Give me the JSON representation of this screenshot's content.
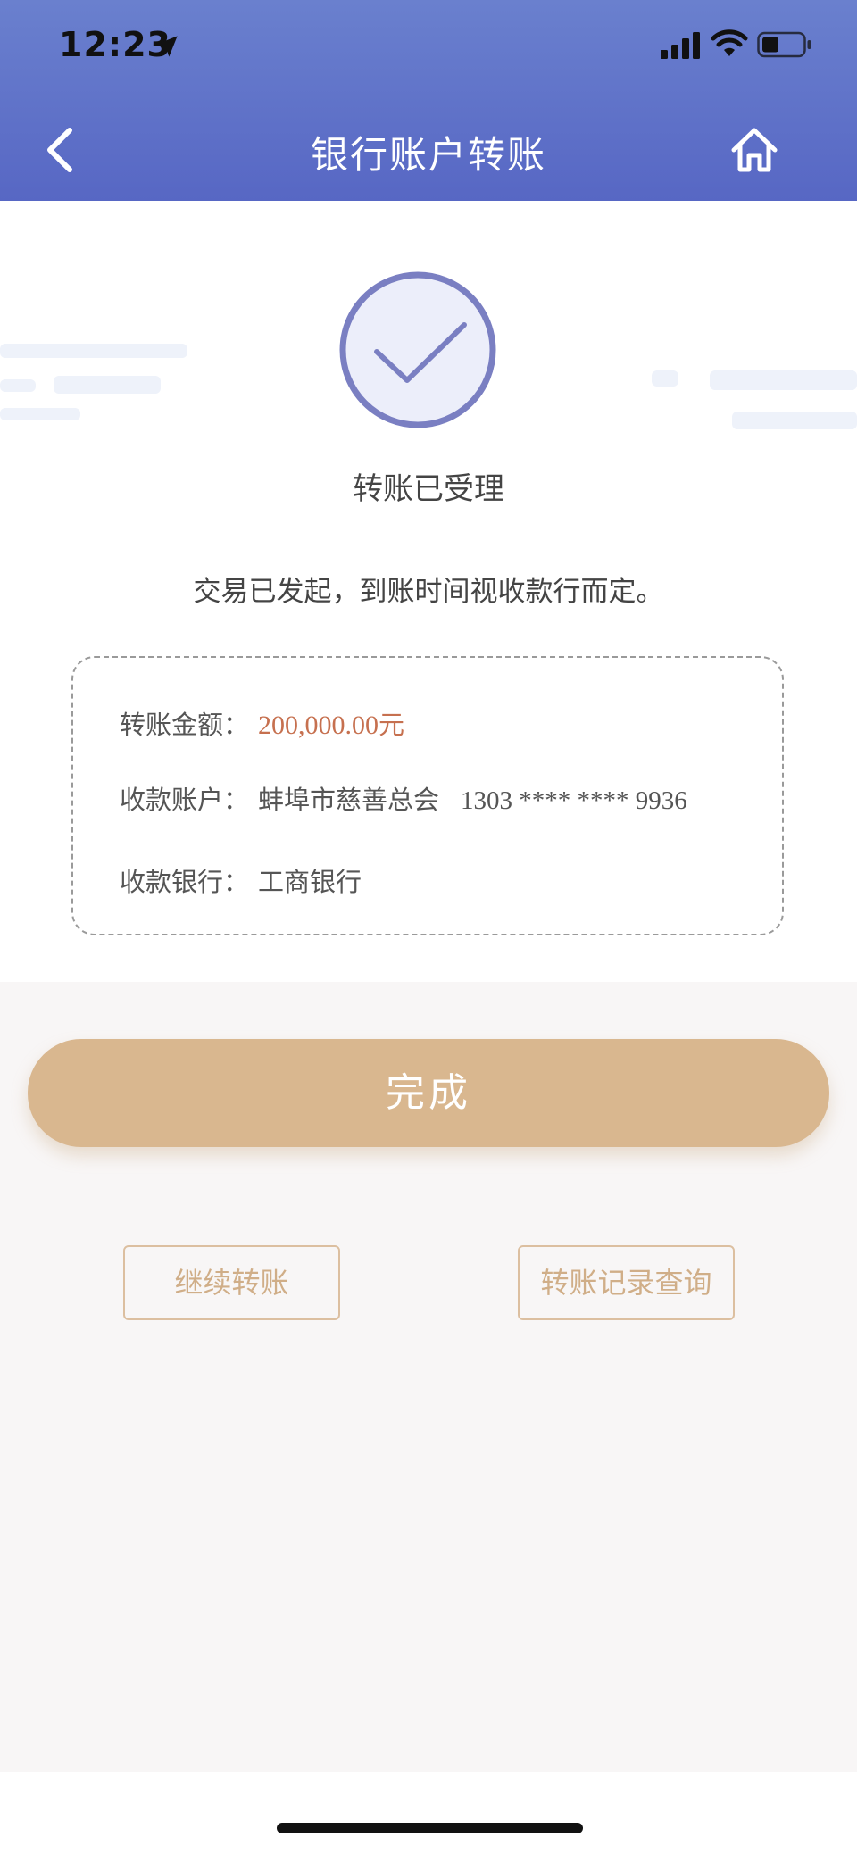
{
  "status_bar": {
    "time": "12:23",
    "location_icon": "location-arrow-icon",
    "signal_icon": "cellular-signal-icon",
    "wifi_icon": "wifi-icon",
    "battery_icon": "battery-icon"
  },
  "nav": {
    "title": "银行账户转账",
    "back_icon": "chevron-left-icon",
    "home_icon": "home-icon"
  },
  "result": {
    "icon": "check-circle-icon",
    "title": "转账已受理",
    "description": "交易已发起，到账时间视收款行而定。"
  },
  "details": {
    "amount_label": "转账金额：",
    "amount_value": "200,000.00",
    "amount_unit": "元",
    "account_label": "收款账户：",
    "account_name": "蚌埠市慈善总会",
    "account_number": "1303 **** **** 9936",
    "bank_label": "收款银行：",
    "bank_value": "工商银行"
  },
  "actions": {
    "done_label": "完成",
    "continue_label": "继续转账",
    "records_label": "转账记录查询"
  },
  "colors": {
    "header_blue": "#5d6fc8",
    "accent_gold": "#d9b78f",
    "amount_red": "#c6704f",
    "icon_purple": "#7a7fc2"
  }
}
